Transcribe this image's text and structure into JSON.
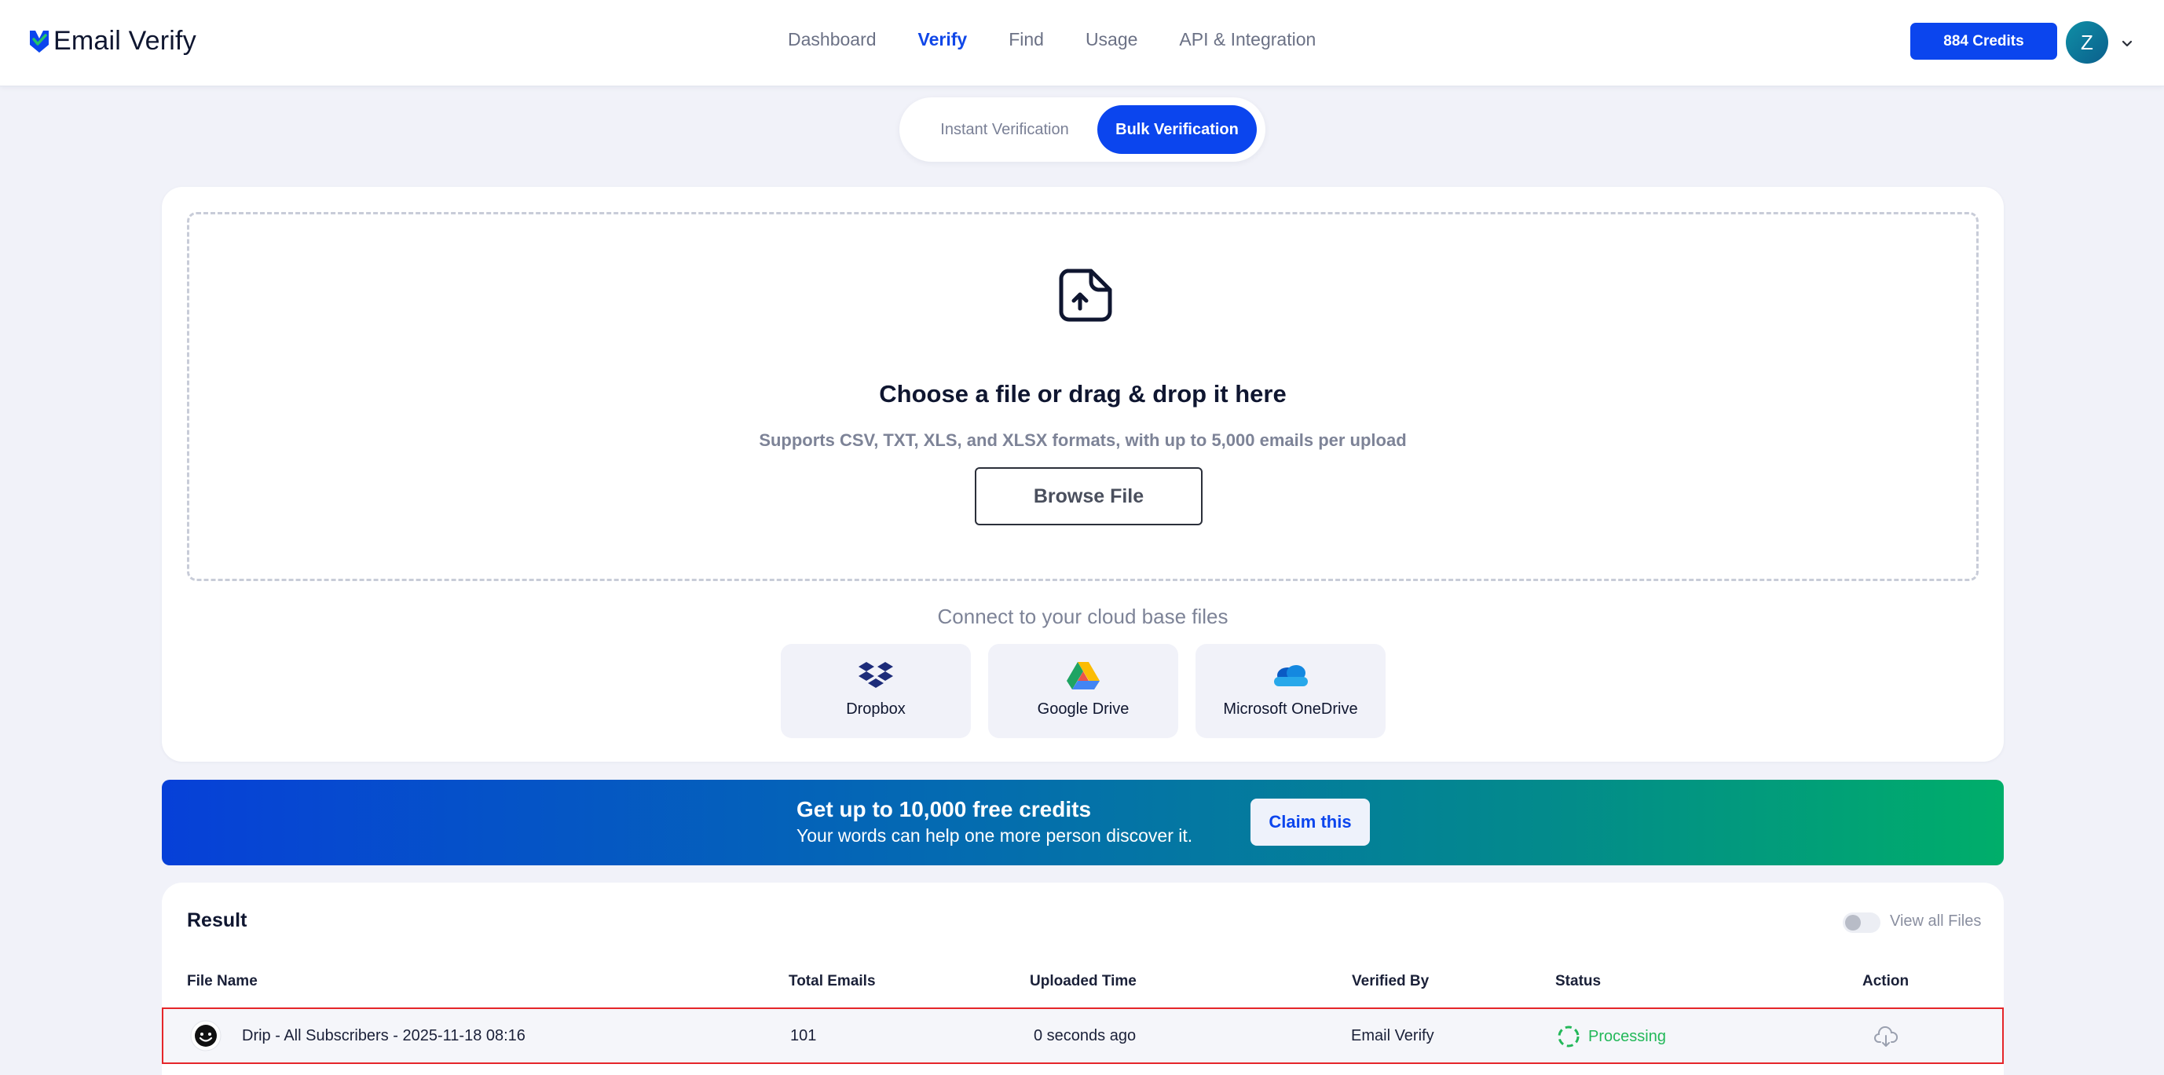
{
  "app": {
    "logo_text": "Email Verify",
    "brand_color": "#0b45ee",
    "accent_green": "#23b859"
  },
  "nav": {
    "items": [
      {
        "label": "Dashboard",
        "active": false
      },
      {
        "label": "Verify",
        "active": true
      },
      {
        "label": "Find",
        "active": false
      },
      {
        "label": "Usage",
        "active": false
      },
      {
        "label": "API & Integration",
        "active": false
      }
    ]
  },
  "account": {
    "credits_label": "884 Credits",
    "avatar_initial": "Z"
  },
  "mode_toggle": {
    "instant": "Instant Verification",
    "bulk": "Bulk Verification",
    "selected": "Bulk Verification"
  },
  "upload": {
    "title": "Choose a file or drag & drop it here",
    "subtitle": "Supports CSV, TXT, XLS, and XLSX formats, with up to 5,000 emails per upload",
    "browse_label": "Browse File",
    "cloud_title": "Connect to your cloud base files",
    "cloud": [
      {
        "label": "Dropbox",
        "icon": "dropbox-icon"
      },
      {
        "label": "Google Drive",
        "icon": "google-drive-icon"
      },
      {
        "label": "Microsoft OneDrive",
        "icon": "onedrive-icon"
      }
    ]
  },
  "promo": {
    "title": "Get up to 10,000 free credits",
    "subtitle": "Your words can help one more person discover it.",
    "button": "Claim this"
  },
  "results": {
    "title": "Result",
    "view_all_label": "View all Files",
    "view_all_on": false,
    "columns": [
      "File Name",
      "Total Emails",
      "Uploaded Time",
      "Verified By",
      "Status",
      "Action"
    ],
    "rows": [
      {
        "file_name": "Drip - All Subscribers - 2025-11-18 08:16",
        "total_emails": "101",
        "uploaded_time": "0 seconds ago",
        "verified_by": "Email Verify",
        "status": "Processing",
        "action_icon": "download-cloud-icon"
      }
    ]
  }
}
